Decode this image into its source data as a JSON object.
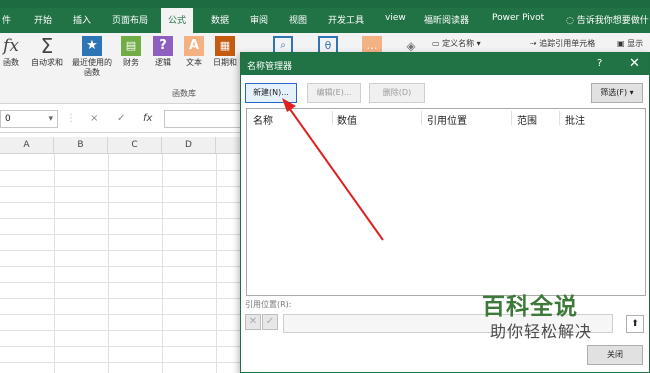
{
  "tabs": {
    "file": "件",
    "home": "开始",
    "insert": "插入",
    "page_layout": "页面布局",
    "formulas": "公式",
    "data": "数据",
    "review": "审阅",
    "view_cn": "视图",
    "developer": "开发工具",
    "view_en": "view",
    "foxit": "福昕阅读器",
    "power_pivot": "Power Pivot",
    "tell_me": "告诉我你想要做什"
  },
  "ribbon": {
    "fx_label": "函数",
    "autosum": "自动求和",
    "recent_line1": "最近使用的",
    "recent_line2": "函数",
    "financial": "财务",
    "logical": "逻辑",
    "text": "文本",
    "datetime": "日期和",
    "library_label": "函数库",
    "define_name": "定义名称",
    "trace_precedents": "追踪引用单元格",
    "show": "显示"
  },
  "formula_bar": {
    "name_box": "0",
    "cancel_symbol": "×",
    "enter_symbol": "✓",
    "fx_symbol": "fx"
  },
  "columns": [
    "A",
    "B",
    "C",
    "D"
  ],
  "dialog": {
    "title": "名称管理器",
    "help": "?",
    "close_x": "✕",
    "new_button": "新建(N)...",
    "edit_button": "编辑(E)...",
    "delete_button": "删除(D)",
    "filter_button": "筛选(F) ▾",
    "headers": {
      "name": "名称",
      "value": "数值",
      "refers_to": "引用位置",
      "scope": "范围",
      "comment": "批注"
    },
    "refers_label": "引用位置(R):",
    "close_button": "关闭"
  },
  "watermark": {
    "title": "百科全说",
    "subtitle": "助你轻松解决"
  },
  "colors": {
    "excel_green": "#217346",
    "arrow_red": "#e02020",
    "focus_blue": "#2a66c7"
  }
}
